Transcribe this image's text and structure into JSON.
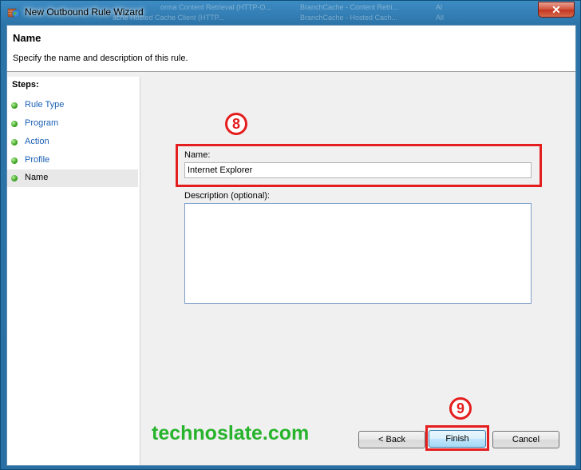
{
  "window": {
    "title": "New Outbound Rule Wizard",
    "close_glyph": "✕",
    "background_strip": [
      "orma Content Retrieval (HTTP-O...",
      "BranchCache - Content Retri...",
      "Al",
      "ache Hosted Cache Client (HTTP...",
      "BranchCache - Hosted Cach...",
      "All"
    ]
  },
  "header": {
    "title": "Name",
    "subtitle": "Specify the name and description of this rule."
  },
  "steps": {
    "title": "Steps:",
    "items": [
      {
        "label": "Rule Type"
      },
      {
        "label": "Program"
      },
      {
        "label": "Action"
      },
      {
        "label": "Profile"
      },
      {
        "label": "Name"
      }
    ]
  },
  "form": {
    "name_label": "Name:",
    "name_value": "Internet Explorer",
    "description_label": "Description (optional):",
    "description_value": ""
  },
  "annotations": {
    "step8": "8",
    "step9": "9",
    "color": "#e41e1e"
  },
  "buttons": {
    "back": "< Back",
    "finish": "Finish",
    "cancel": "Cancel"
  },
  "watermark": {
    "text": "technoslate.com",
    "color": "#27b32b"
  },
  "icons": {
    "app": "firewall-globe-icon",
    "step_bullet": "green-dot-icon"
  }
}
